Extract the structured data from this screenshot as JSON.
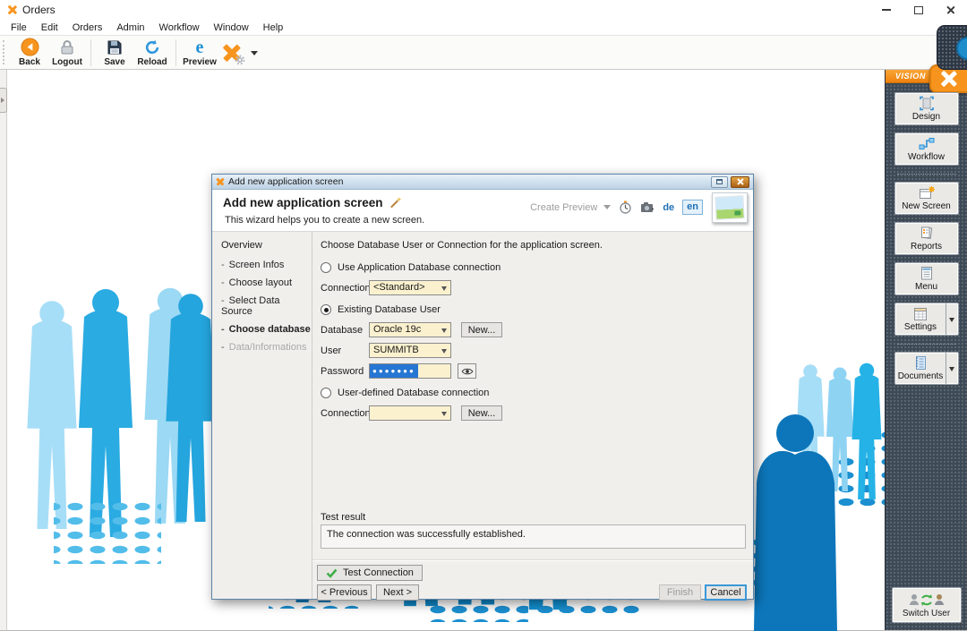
{
  "theme": {
    "accent": "#f7941e",
    "blue_medium": "#29abe2",
    "blue_light": "#a7def7",
    "blue_dark": "#0e7ec2",
    "sidebar_bg": "#3e4956",
    "combo_bg": "#fbf1cf",
    "selection": "#2676d3",
    "link_blue": "#1f6fb5",
    "cancel_border": "#3a98d8",
    "check_green": "#3fae49"
  },
  "window": {
    "title": "Orders"
  },
  "menu": {
    "items": [
      "File",
      "Edit",
      "Orders",
      "Admin",
      "Workflow",
      "Window",
      "Help"
    ]
  },
  "toolbar": {
    "back": "Back",
    "logout": "Logout",
    "save": "Save",
    "reload": "Reload",
    "preview": "Preview"
  },
  "icons": {
    "preview_glyph": "e"
  },
  "sidebar": {
    "brand": "VISION",
    "design": "Design",
    "workflow": "Workflow",
    "new_screen": "New Screen",
    "reports": "Reports",
    "menu": "Menu",
    "settings": "Settings",
    "documents": "Documents",
    "switch_user": "Switch User"
  },
  "dialog": {
    "titlebar_title": "Add new application screen",
    "title": "Add new application screen",
    "subtitle": "This wizard helps you to create a new screen.",
    "create_preview": "Create Preview",
    "lang_de": "de",
    "lang_en": "en",
    "nav_header": "Overview",
    "nav_items": [
      "Screen Infos",
      "Choose layout",
      "Select Data Source",
      "Choose database",
      "Data/Informations"
    ],
    "form": {
      "instruction": "Choose Database User or Connection for the application screen.",
      "option_app_connection": "Use Application Database connection",
      "connection_label": "Connection",
      "connection_value": "<Standard>",
      "option_existing_user": "Existing Database User",
      "database_label": "Database",
      "database_value": "Oracle 19c",
      "new_label": "New...",
      "user_label": "User",
      "user_value": "SUMMITB",
      "password_label": "Password",
      "password_masked": "●●●●●●●",
      "option_user_defined": "User-defined Database connection",
      "connection2_label": "Connection",
      "connection2_value": "",
      "test_result_label": "Test result",
      "test_result_text": "The connection was successfully established.",
      "buttons": {
        "test": "Test Connection",
        "previous": "< Previous",
        "next": "Next >",
        "finish": "Finish",
        "cancel": "Cancel"
      }
    }
  }
}
